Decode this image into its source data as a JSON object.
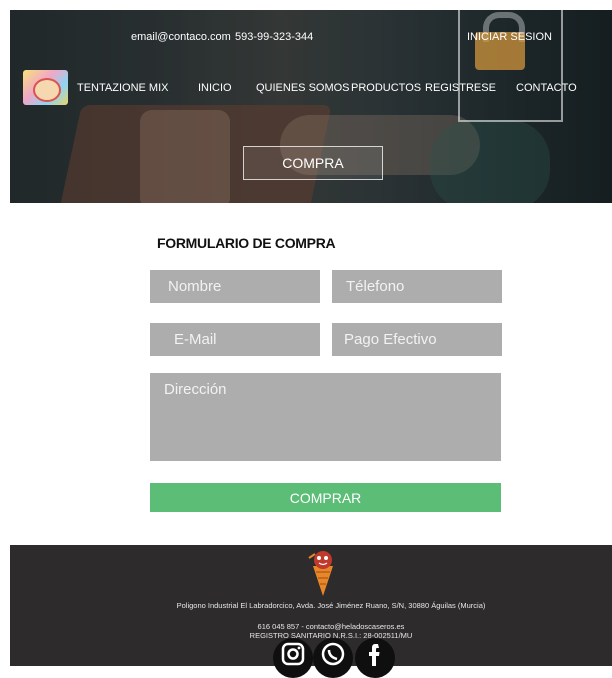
{
  "topbar": {
    "email": "email@contaco.com",
    "phone": "593-99-323-344",
    "login": "INICIAR SESION"
  },
  "brand": {
    "name": "TENTAZIONE MIX"
  },
  "nav": {
    "items": [
      "INICIO",
      "QUIENES SOMOS",
      "PRODUCTOS",
      "REGISTRESE",
      "CONTACTO"
    ]
  },
  "hero": {
    "button": "COMPRA"
  },
  "form": {
    "title": "FORMULARIO DE COMPRA",
    "nombre": "Nombre",
    "telefono": "Télefono",
    "email": "E-Mail",
    "pago": "Pago Efectivo",
    "direccion": "Dirección",
    "submit": "COMPRAR"
  },
  "footer": {
    "address_line1": "Poligono Industrial El Labradorcico, Avda. José Jiménez Ruano, S/N, 30880 Águilas (Murcia)",
    "address_line2": "616 045 857 -  contacto@heladoscaseros.es",
    "address_line3": "REGISTRO SANITARIO N.R.S.I.: 28-002511/MU"
  },
  "icons": {
    "lock": "lock-icon",
    "logo": "ice-cream-logo",
    "mascot": "ice-cream-cone-mascot-icon",
    "social": [
      "instagram-icon",
      "whatsapp-icon",
      "facebook-icon"
    ]
  },
  "colors": {
    "footer_bg": "#2d2b2b",
    "field_bg": "#adadad",
    "submit_bg": "#5bbd76"
  }
}
